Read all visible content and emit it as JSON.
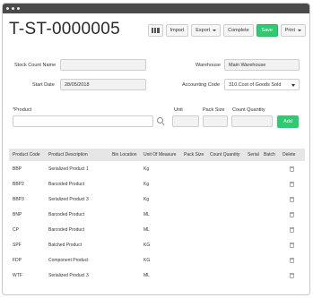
{
  "document": {
    "title": "T-ST-0000005"
  },
  "toolbar": {
    "import_label": "Import",
    "export_label": "Export",
    "complete_label": "Complete",
    "save_label": "Save",
    "print_label": "Print",
    "save_color": "#2ecc71"
  },
  "form": {
    "stock_count_name": {
      "label": "Stock Count Name",
      "value": ""
    },
    "start_date": {
      "label": "Start Date",
      "value": "28/05/2018"
    },
    "warehouse": {
      "label": "Warehouse",
      "value": "Main Warehouse"
    },
    "accounting_code": {
      "label": "Accounting Code",
      "value": "310.Cost of Goods Sold"
    }
  },
  "product_entry": {
    "product_label": "*Product",
    "product_value": "",
    "unit_label": "Unit",
    "pack_size_label": "Pack Size",
    "count_quantity_label": "Count Quantity",
    "unit_value": "",
    "pack_size_value": "",
    "count_quantity_value": "",
    "add_label": "Add"
  },
  "table": {
    "headers": [
      "Product Code",
      "Product Description",
      "Bin Location",
      "Unit Of Measure",
      "Pack Size",
      "Count Quantity",
      "Serial",
      "Batch",
      "Delete"
    ],
    "rows": [
      {
        "code": "BBP",
        "description": "Serialized Product 1",
        "uom": "Kg"
      },
      {
        "code": "BBP2",
        "description": "Barcoded Product",
        "uom": "Kg"
      },
      {
        "code": "BBP3",
        "description": "Serialized Product 3",
        "uom": "Kg"
      },
      {
        "code": "BNP",
        "description": "Barcoded Product",
        "uom": "ML"
      },
      {
        "code": "CP",
        "description": "Barcoded Product",
        "uom": "ML"
      },
      {
        "code": "SPF",
        "description": "Batched Product",
        "uom": "KG"
      },
      {
        "code": "FDP",
        "description": "Component Product",
        "uom": "KG"
      },
      {
        "code": "WTF",
        "description": "Serialized Product 3",
        "uom": "ML"
      }
    ]
  }
}
